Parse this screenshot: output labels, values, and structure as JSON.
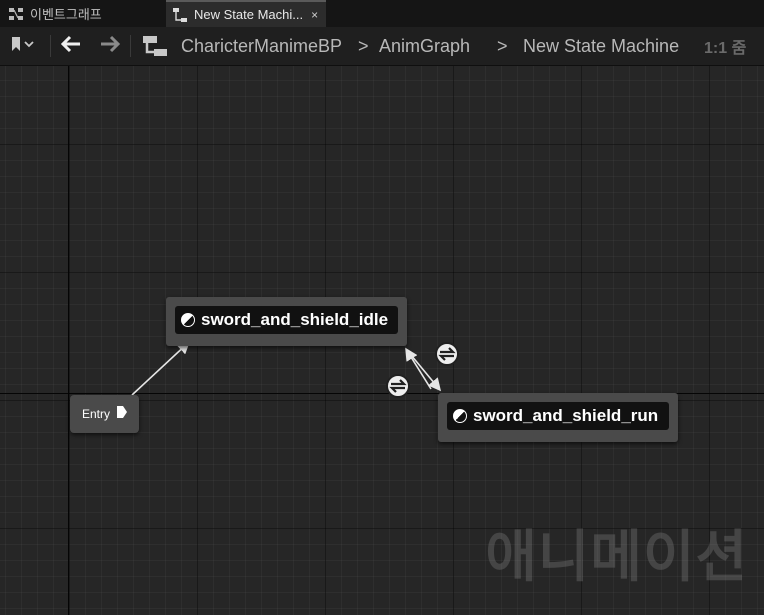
{
  "tabs": [
    {
      "label": "이벤트그래프",
      "active": false
    },
    {
      "label": "New State Machi...",
      "active": true,
      "close": "×"
    }
  ],
  "breadcrumb": {
    "blueprint": "CharicterManimeBP",
    "separator1": ">",
    "graph": "AnimGraph",
    "separator2": ">",
    "state_machine": "New State Machine",
    "zoom": "1:1 줌"
  },
  "graph": {
    "entry_label": "Entry",
    "states": [
      {
        "name": "sword_and_shield_idle"
      },
      {
        "name": "sword_and_shield_run"
      }
    ],
    "watermark": "애니메이션"
  },
  "colors": {
    "background": "#262626",
    "node": "#4a4a4a",
    "node_inner": "#111111",
    "wire": "#e6e6e6"
  }
}
